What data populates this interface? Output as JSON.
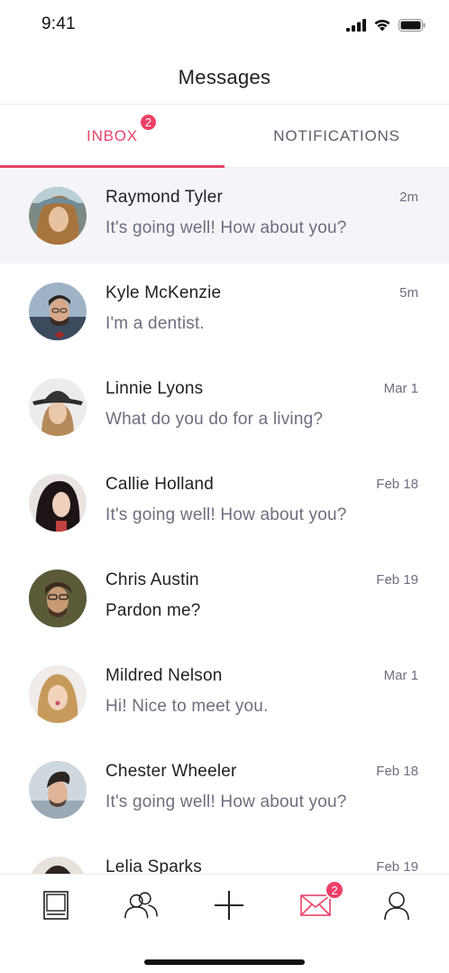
{
  "status_bar": {
    "time": "9:41"
  },
  "header": {
    "title": "Messages"
  },
  "tabs": [
    {
      "label": "INBOX",
      "badge": "2",
      "active": true
    },
    {
      "label": "NOTIFICATIONS",
      "active": false
    }
  ],
  "colors": {
    "accent": "#e8436a",
    "badge": "#ee3f66",
    "selected_row": "#f5f5f9"
  },
  "conversations": [
    {
      "name": "Raymond Tyler",
      "message": "It's going well! How about you?",
      "time": "2m",
      "selected": true
    },
    {
      "name": "Kyle McKenzie",
      "message": "I'm a dentist.",
      "time": "5m"
    },
    {
      "name": "Linnie Lyons",
      "message": "What do you do for a living?",
      "time": "Mar 1"
    },
    {
      "name": "Callie Holland",
      "message": "It's going well! How about you?",
      "time": "Feb 18"
    },
    {
      "name": "Chris Austin",
      "message": "Pardon me?",
      "time": "Feb 19",
      "unread": true
    },
    {
      "name": "Mildred Nelson",
      "message": "Hi! Nice to meet you.",
      "time": "Mar 1"
    },
    {
      "name": "Chester Wheeler",
      "message": "It's going well! How about you?",
      "time": "Feb 18"
    },
    {
      "name": "Lelia Sparks",
      "message": "",
      "time": "Feb 19"
    }
  ],
  "bottom_nav": [
    {
      "icon": "newsfeed-icon"
    },
    {
      "icon": "contacts-icon"
    },
    {
      "icon": "plus-icon"
    },
    {
      "icon": "mail-icon",
      "badge": "2"
    },
    {
      "icon": "profile-icon"
    }
  ]
}
